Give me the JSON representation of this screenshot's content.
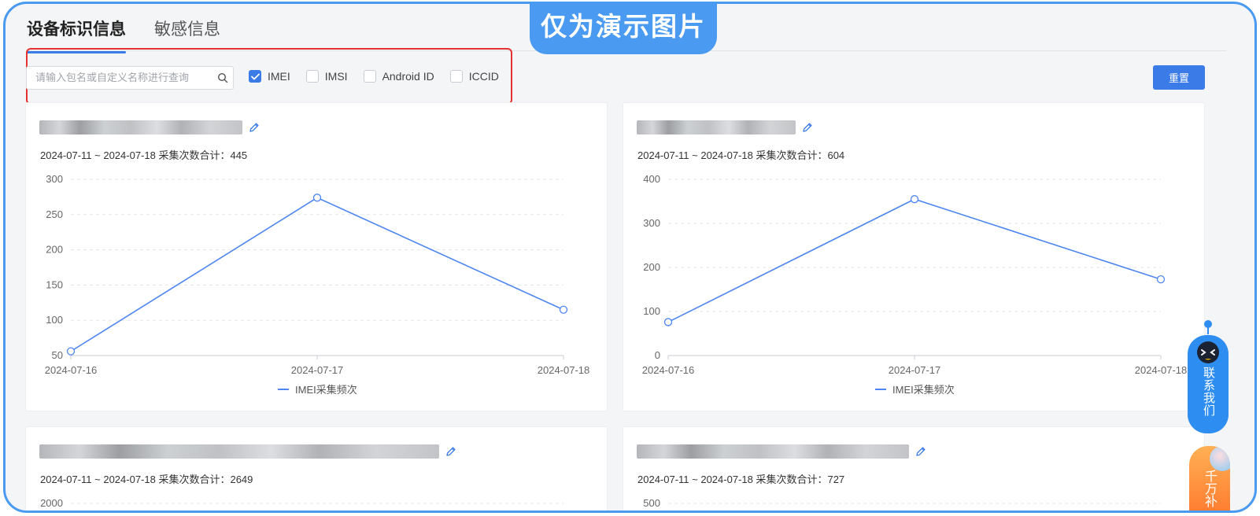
{
  "tabs": [
    {
      "label": "设备标识信息",
      "active": true
    },
    {
      "label": "敏感信息",
      "active": false
    }
  ],
  "watermark_badge": "仅为演示图片",
  "filter": {
    "search_placeholder": "请输入包名或自定义名称进行查询",
    "checkboxes": [
      {
        "label": "IMEI",
        "checked": true
      },
      {
        "label": "IMSI",
        "checked": false
      },
      {
        "label": "Android ID",
        "checked": false
      },
      {
        "label": "ICCID",
        "checked": false
      }
    ],
    "reset_label": "重置"
  },
  "cards": [
    {
      "summary": "2024-07-11 ~ 2024-07-18 采集次数合计：445"
    },
    {
      "summary": "2024-07-11 ~ 2024-07-18 采集次数合计：604"
    },
    {
      "summary": "2024-07-11 ~ 2024-07-18 采集次数合计：2649"
    },
    {
      "summary": "2024-07-11 ~ 2024-07-18 采集次数合计：727"
    }
  ],
  "chart_data": [
    {
      "type": "line",
      "x": [
        "2024-07-16",
        "2024-07-17",
        "2024-07-18"
      ],
      "series": [
        {
          "name": "IMEI采集频次",
          "values": [
            56,
            274,
            115
          ]
        }
      ],
      "ylim": [
        50,
        300
      ],
      "yticks": [
        "50",
        "100",
        "150",
        "200",
        "250",
        "300"
      ],
      "grid": true,
      "legend": "bottom",
      "color": "#4d86f0"
    },
    {
      "type": "line",
      "x": [
        "2024-07-16",
        "2024-07-17",
        "2024-07-18"
      ],
      "series": [
        {
          "name": "IMEI采集频次",
          "values": [
            76,
            355,
            173
          ]
        }
      ],
      "ylim": [
        0,
        400
      ],
      "yticks": [
        "0",
        "100",
        "200",
        "300",
        "400"
      ],
      "grid": true,
      "legend": "bottom",
      "color": "#4d86f0"
    },
    {
      "type": "line",
      "yticks": [
        "2000"
      ]
    },
    {
      "type": "line",
      "yticks": [
        "500"
      ]
    }
  ],
  "widgets": {
    "contact_label": "联系我们",
    "promo_label": "千万补"
  }
}
